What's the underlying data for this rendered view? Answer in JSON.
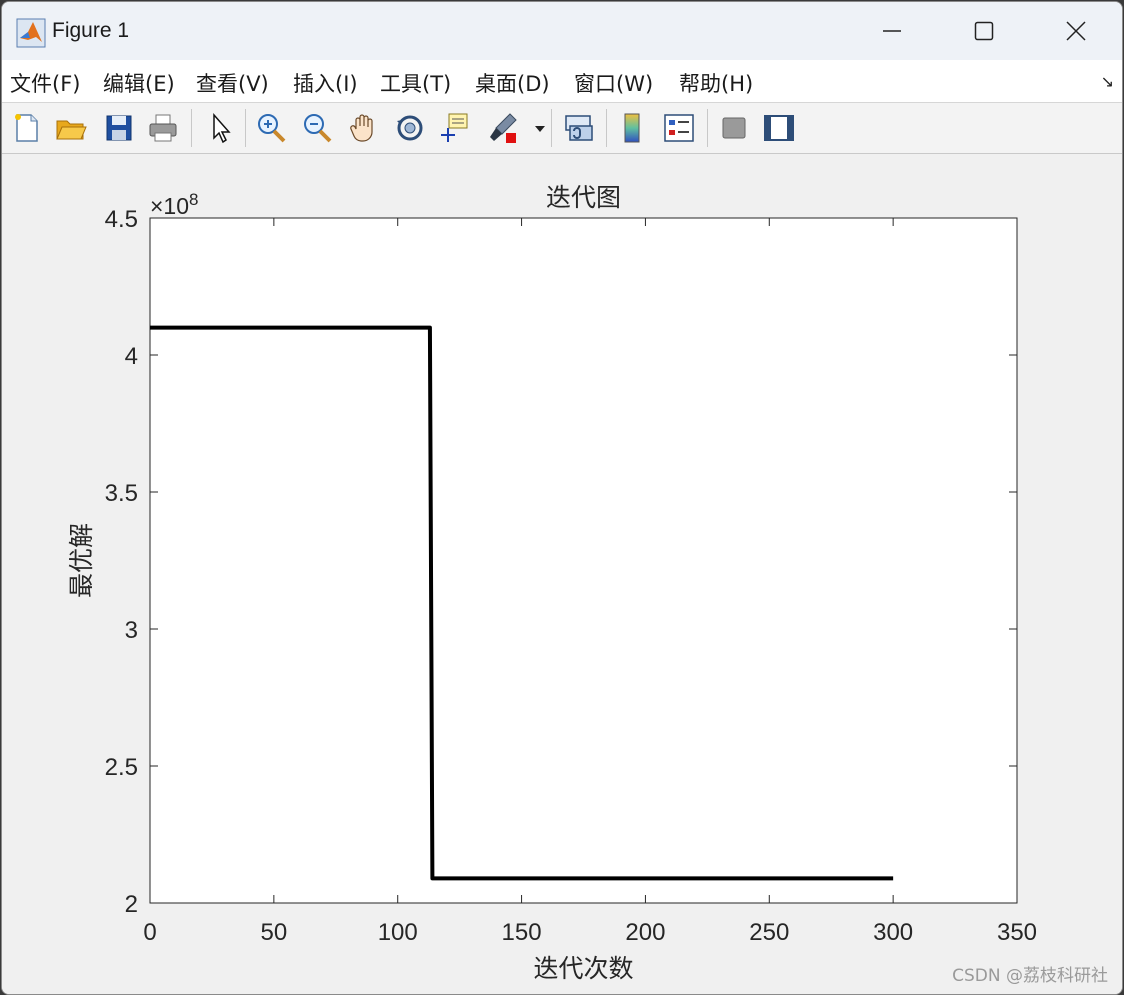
{
  "window": {
    "title": "Figure 1"
  },
  "menu": [
    {
      "label": "文件(F)"
    },
    {
      "label": "编辑(E)"
    },
    {
      "label": "查看(V)"
    },
    {
      "label": "插入(I)"
    },
    {
      "label": "工具(T)"
    },
    {
      "label": "桌面(D)"
    },
    {
      "label": "窗口(W)"
    },
    {
      "label": "帮助(H)"
    }
  ],
  "toolbar": {
    "icons": [
      "new-figure-icon",
      "open-file-icon",
      "save-icon",
      "print-icon",
      "select-arrow-icon",
      "zoom-in-icon",
      "zoom-out-icon",
      "pan-hand-icon",
      "rotate-3d-icon",
      "data-cursor-icon",
      "brush-icon",
      "link-plot-icon",
      "colorbar-icon",
      "legend-icon",
      "hide-plot-tools-icon",
      "show-plot-tools-icon"
    ]
  },
  "chart_data": {
    "type": "line",
    "title": "迭代图",
    "xlabel": "迭代次数",
    "ylabel": "最优解",
    "xlim": [
      0,
      350
    ],
    "ylim": [
      200000000,
      450000000
    ],
    "x_ticks": [
      "0",
      "50",
      "100",
      "150",
      "200",
      "250",
      "300",
      "350"
    ],
    "y_ticks": [
      "2",
      "2.5",
      "3",
      "3.5",
      "4",
      "4.5"
    ],
    "y_exponent_label": "×10",
    "y_exponent": "8",
    "grid": false,
    "series": [
      {
        "color": "#000000",
        "x": [
          0,
          113,
          114,
          300
        ],
        "y": [
          410000000,
          410000000,
          209000000,
          209000000
        ]
      }
    ]
  },
  "watermark": "CSDN @荔枝科研社"
}
